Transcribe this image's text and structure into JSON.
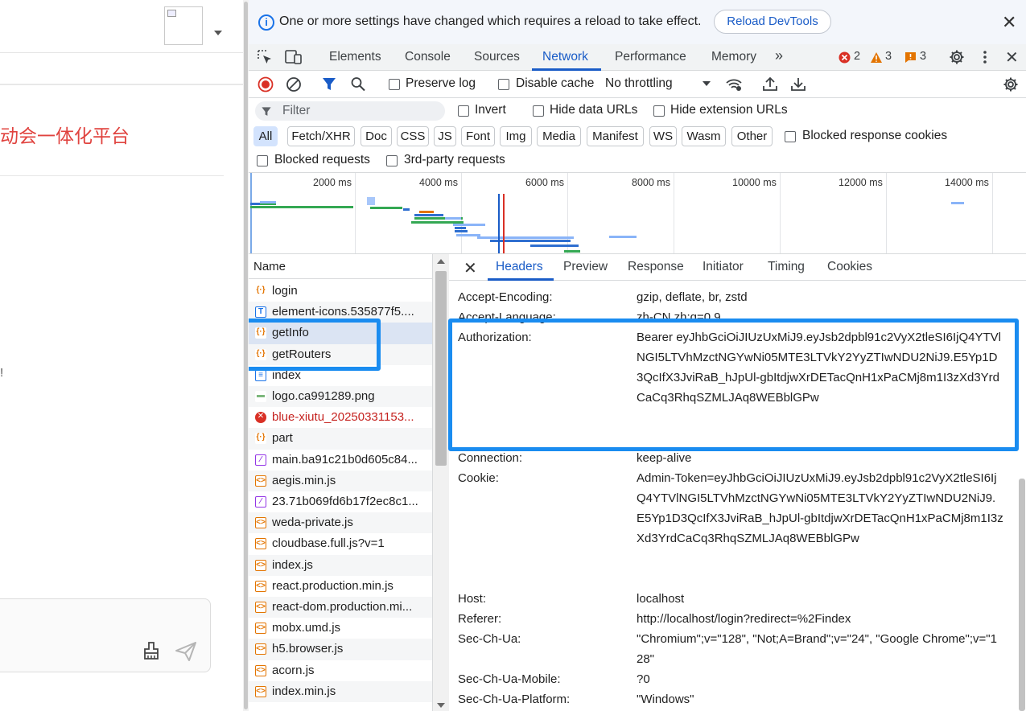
{
  "app": {
    "page_title": "动会一体化平台",
    "fragment": "!"
  },
  "infobar": {
    "message": "One or more settings have changed which requires a reload to take effect.",
    "reload_label": "Reload DevTools"
  },
  "main_tabs": [
    "Elements",
    "Console",
    "Sources",
    "Network",
    "Performance",
    "Memory"
  ],
  "main_tabs_selected": "Network",
  "status_counts": {
    "errors": "2",
    "warnings": "3",
    "issues": "3"
  },
  "toolbar": {
    "preserve_log": "Preserve log",
    "disable_cache": "Disable cache",
    "throttling": "No throttling"
  },
  "filter": {
    "placeholder": "Filter",
    "invert": "Invert",
    "hide_data_urls": "Hide data URLs",
    "hide_extension_urls": "Hide extension URLs"
  },
  "type_filters": [
    "All",
    "Fetch/XHR",
    "Doc",
    "CSS",
    "JS",
    "Font",
    "Img",
    "Media",
    "Manifest",
    "WS",
    "Wasm",
    "Other"
  ],
  "type_filter_selected": "All",
  "blocked_response_cookies": "Blocked response cookies",
  "blocked_requests": "Blocked requests",
  "third_party_requests": "3rd-party requests",
  "overview_ticks": [
    "2000 ms",
    "4000 ms",
    "6000 ms",
    "8000 ms",
    "10000 ms",
    "12000 ms",
    "14000 ms"
  ],
  "name_header": "Name",
  "requests": [
    {
      "name": "login",
      "kind": "xhr"
    },
    {
      "name": "element-icons.535877f5....",
      "kind": "font"
    },
    {
      "name": "getInfo",
      "kind": "xhr"
    },
    {
      "name": "getRouters",
      "kind": "xhr"
    },
    {
      "name": "index",
      "kind": "doc"
    },
    {
      "name": "logo.ca991289.png",
      "kind": "img"
    },
    {
      "name": "blue-xiutu_20250331153...",
      "kind": "error"
    },
    {
      "name": "part",
      "kind": "xhr"
    },
    {
      "name": "main.ba91c21b0d605c84...",
      "kind": "css"
    },
    {
      "name": "aegis.min.js",
      "kind": "js"
    },
    {
      "name": "23.71b069fd6b17f2ec8c1...",
      "kind": "css"
    },
    {
      "name": "weda-private.js",
      "kind": "js"
    },
    {
      "name": "cloudbase.full.js?v=1",
      "kind": "js"
    },
    {
      "name": "index.js",
      "kind": "js"
    },
    {
      "name": "react.production.min.js",
      "kind": "js"
    },
    {
      "name": "react-dom.production.mi...",
      "kind": "js"
    },
    {
      "name": "mobx.umd.js",
      "kind": "js"
    },
    {
      "name": "h5.browser.js",
      "kind": "js"
    },
    {
      "name": "acorn.js",
      "kind": "js"
    },
    {
      "name": "index.min.js",
      "kind": "js"
    }
  ],
  "selected_request": "getInfo",
  "detail_tabs": [
    "Headers",
    "Preview",
    "Response",
    "Initiator",
    "Timing",
    "Cookies"
  ],
  "detail_tab_selected": "Headers",
  "headers": [
    {
      "key": "Accept-Encoding:",
      "value": "gzip, deflate, br, zstd"
    },
    {
      "key": "Accept-Language:",
      "value": "zh-CN,zh;q=0.9"
    },
    {
      "key": "Authorization:",
      "value": "Bearer eyJhbGciOiJIUzUxMiJ9.eyJsb2dpbl91c2VyX2tleSI6IjQ4YTVlNGI5LTVhMzctNGYwNi05MTE3LTVkY2YyZTIwNDU2NiJ9.E5Yp1D3QcIfX3JviRaB_hJpUl-gbItdjwXrDETacQnH1xPaCMj8m1I3zXd3YrdCaCq3RhqSZMLJAq8WEBblGPw"
    },
    {
      "key": "Connection:",
      "value": "keep-alive"
    },
    {
      "key": "Cookie:",
      "value": "Admin-Token=eyJhbGciOiJIUzUxMiJ9.eyJsb2dpbl91c2VyX2tleSI6IjQ4YTVlNGI5LTVhMzctNGYwNi05MTE3LTVkY2YyZTIwNDU2NiJ9.E5Yp1D3QcIfX3JviRaB_hJpUl-gbItdjwXrDETacQnH1xPaCMj8m1I3zXd3YrdCaCq3RhqSZMLJAq8WEBblGPw"
    },
    {
      "key": "Host:",
      "value": "localhost"
    },
    {
      "key": "Referer:",
      "value": "http://localhost/login?redirect=%2Findex"
    },
    {
      "key": "Sec-Ch-Ua:",
      "value": "\"Chromium\";v=\"128\", \"Not;A=Brand\";v=\"24\", \"Google Chrome\";v=\"128\""
    },
    {
      "key": "Sec-Ch-Ua-Mobile:",
      "value": "?0"
    },
    {
      "key": "Sec-Ch-Ua-Platform:",
      "value": "\"Windows\""
    }
  ],
  "colors": {
    "accent": "#1a5cc7",
    "highlight": "#1a8cf0",
    "error": "#d93025",
    "warning": "#e37400"
  }
}
